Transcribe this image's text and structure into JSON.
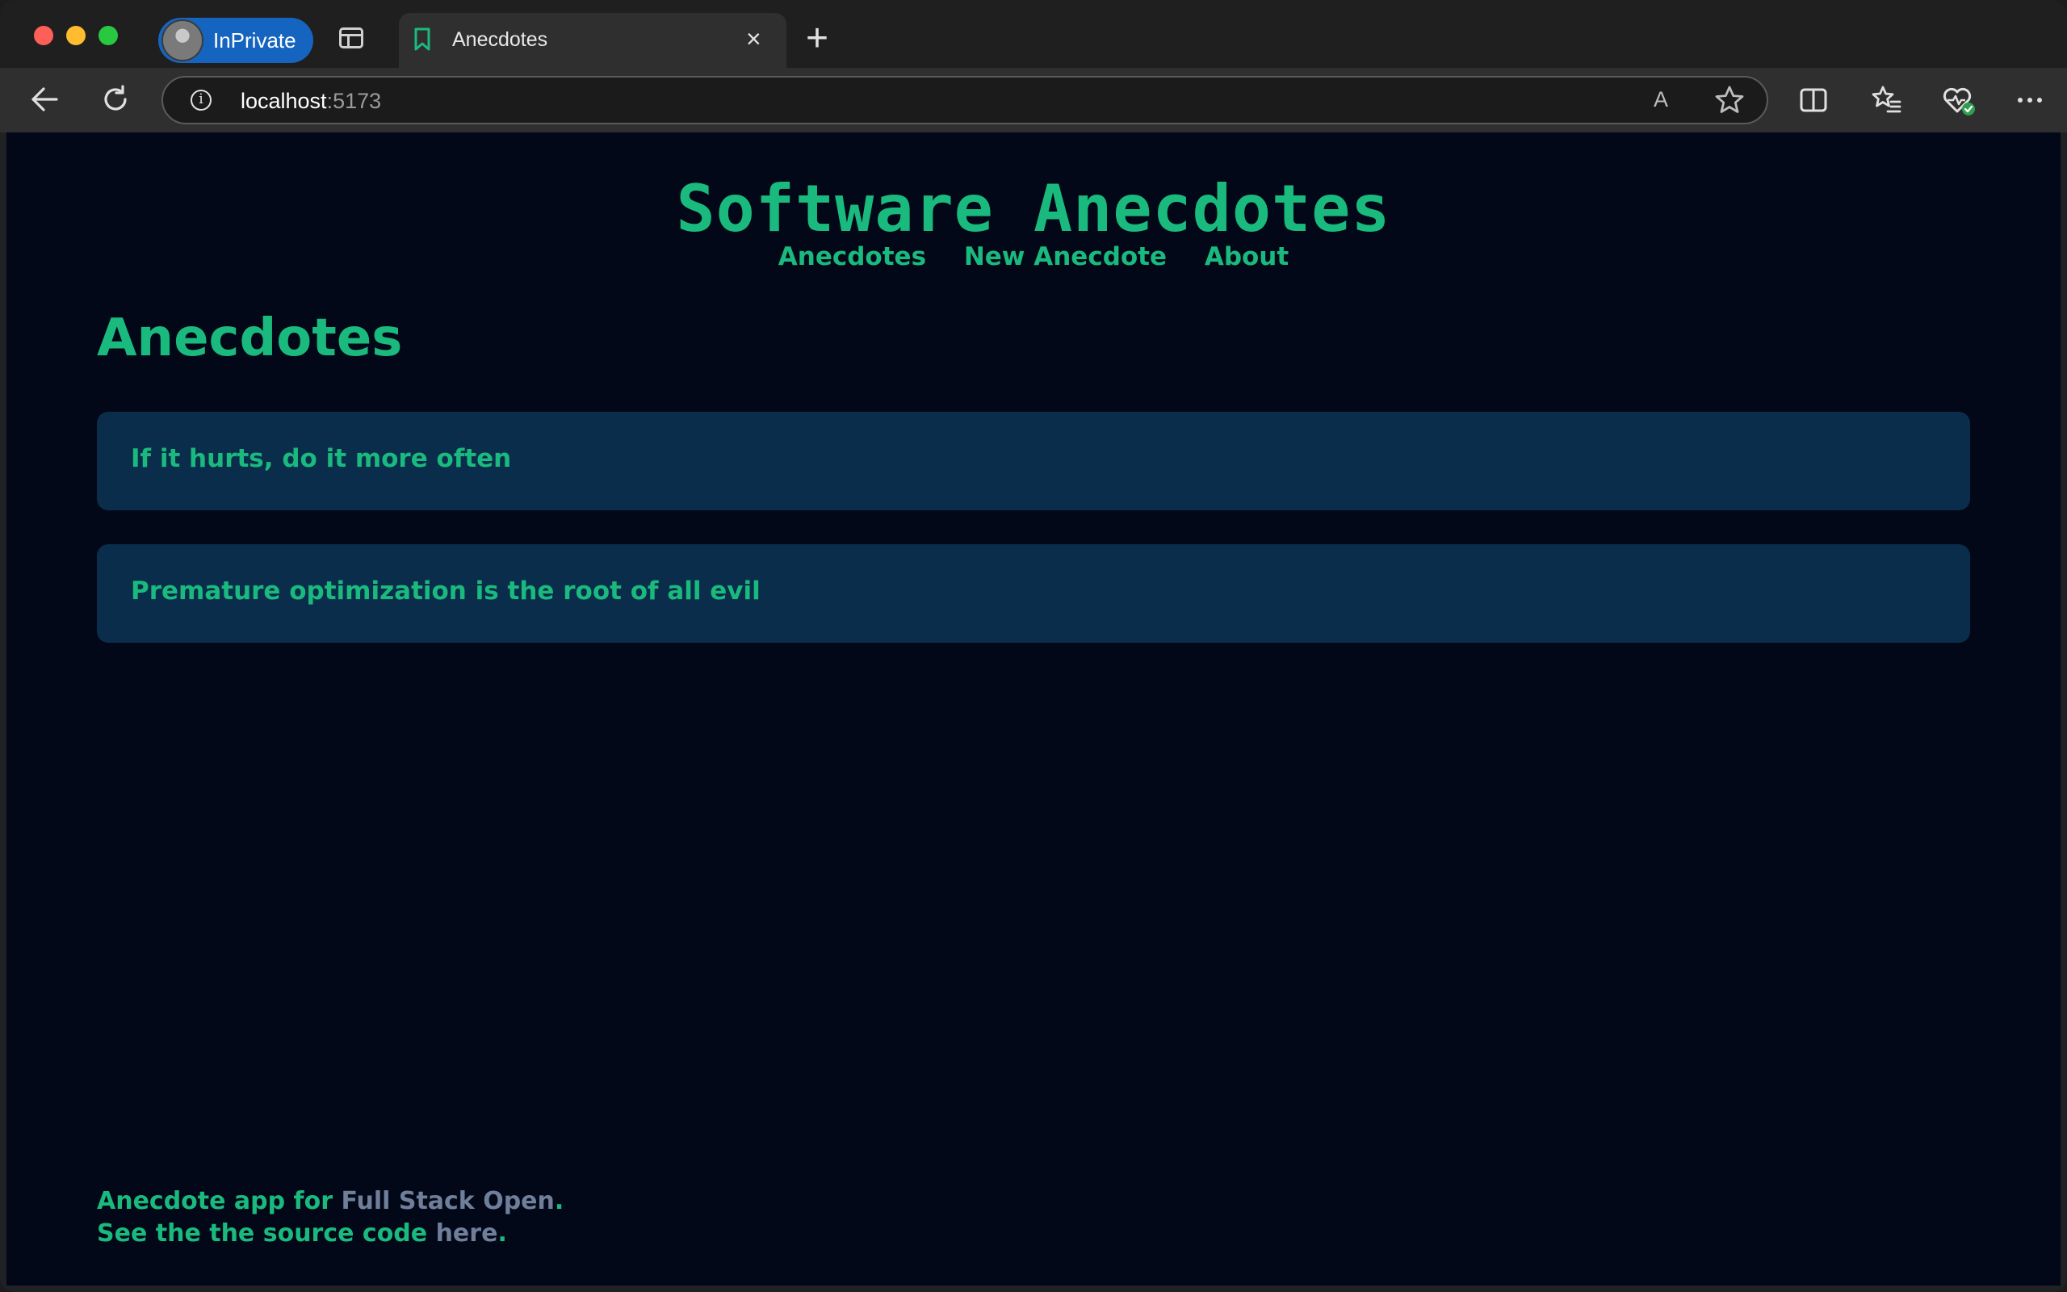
{
  "browser": {
    "profile_label": "InPrivate",
    "tab_title": "Anecdotes",
    "new_tab_label": "+",
    "close_label": "×",
    "url_host": "localhost",
    "url_port": ":5173",
    "read_aloud_label": "A"
  },
  "site": {
    "title": "Software Anecdotes",
    "nav": [
      "Anecdotes",
      "New Anecdote",
      "About"
    ]
  },
  "main": {
    "heading": "Anecdotes",
    "anecdotes": [
      "If it hurts, do it more often",
      "Premature optimization is the root of all evil"
    ]
  },
  "footer": {
    "line1_prefix": "Anecdote app for ",
    "line1_link": "Full Stack Open",
    "line1_suffix": ".",
    "line2_prefix": "See the the source code ",
    "line2_link": "here",
    "line2_suffix": "."
  },
  "colors": {
    "page_bg": "#030818",
    "accent": "#1aba7e",
    "card_bg": "#0a2d4b",
    "link_muted": "#6f7f9a"
  }
}
